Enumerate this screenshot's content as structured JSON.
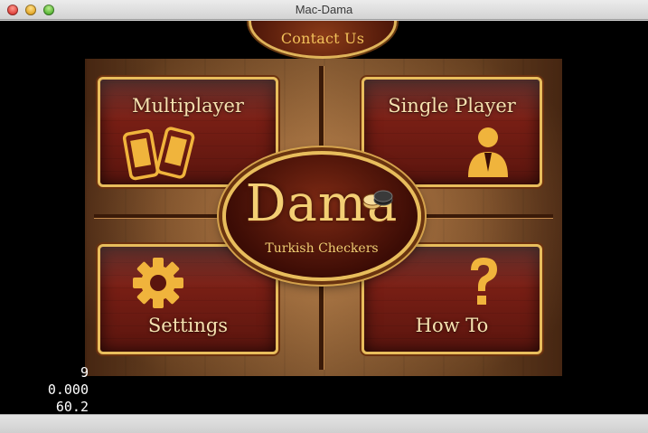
{
  "window": {
    "title": "Mac-Dama"
  },
  "contact": {
    "label": "Contact Us"
  },
  "menu": {
    "multiplayer": {
      "label": "Multiplayer",
      "icon": "phones-icon"
    },
    "single_player": {
      "label": "Single Player",
      "icon": "person-icon"
    },
    "settings": {
      "label": "Settings",
      "icon": "gear-icon"
    },
    "how_to": {
      "label": "How To",
      "icon": "question-mark-icon"
    }
  },
  "logo": {
    "title": "Dama",
    "subtitle": "Turkish Checkers"
  },
  "stats": {
    "line1": "9",
    "line2": "0.000",
    "line3": "60.2"
  },
  "colors": {
    "gold": "#e8bd5c",
    "maroon": "#5a150e",
    "wood": "#9a6030"
  }
}
